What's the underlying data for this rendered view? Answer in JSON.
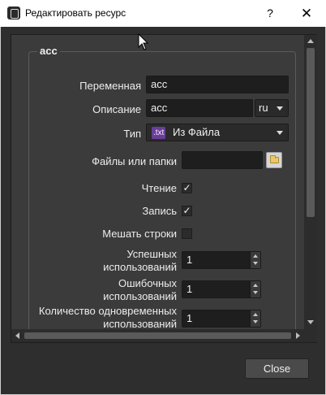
{
  "window": {
    "title": "Редактировать ресурс",
    "help_glyph": "?",
    "close_glyph": "✕"
  },
  "group": {
    "title": "acc"
  },
  "form": {
    "variable": {
      "label": "Переменная",
      "value": "acc"
    },
    "description": {
      "label": "Описание",
      "value": "acc",
      "lang": "ru"
    },
    "type": {
      "label": "Тип",
      "badge": ".txt",
      "value": "Из Файла"
    },
    "files": {
      "label": "Файлы или папки",
      "value": ""
    },
    "read": {
      "label": "Чтение",
      "checked": true
    },
    "write": {
      "label": "Запись",
      "checked": true
    },
    "shuffle": {
      "label": "Мешать строки",
      "checked": false
    },
    "success_uses": {
      "label_line1": "Успешных",
      "label_line2": "использований",
      "value": "1"
    },
    "error_uses": {
      "label_line1": "Ошибочных",
      "label_line2": "использований",
      "value": "1"
    },
    "concurrent_uses": {
      "label_line1": "Количество одновременных",
      "label_line2": "использований",
      "value": "1"
    }
  },
  "check_glyph": "✓",
  "footer": {
    "close_label": "Close"
  },
  "colors": {
    "background": "#2e2e2e",
    "panel": "#3b3b3b",
    "field": "#1e1e1e",
    "badge": "#6a3d9a"
  }
}
